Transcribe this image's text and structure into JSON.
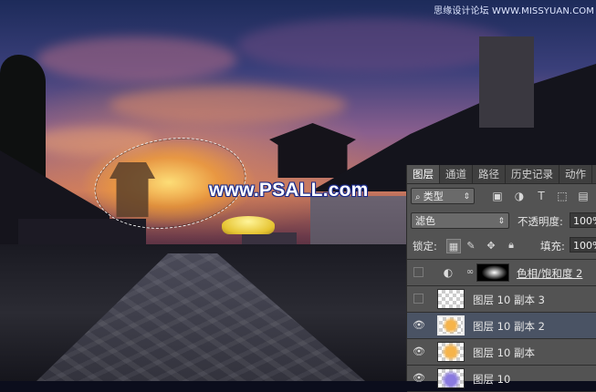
{
  "watermark": {
    "top_right": "思缘设计论坛 WWW.MISSYUAN.COM",
    "center": "www.PSALL.com"
  },
  "panel": {
    "tabs": [
      {
        "label": "图层",
        "active": true
      },
      {
        "label": "通道",
        "active": false
      },
      {
        "label": "路径",
        "active": false
      },
      {
        "label": "历史记录",
        "active": false
      },
      {
        "label": "动作",
        "active": false
      }
    ],
    "filter": {
      "kind_label": "类型"
    },
    "blend": {
      "mode": "滤色",
      "opacity_label": "不透明度:",
      "opacity_value": "100%"
    },
    "lock": {
      "label": "锁定:",
      "fill_label": "填充:",
      "fill_value": "100%"
    },
    "layers": [
      {
        "name": "色相/饱和度 2",
        "visible": false,
        "type": "adjustment"
      },
      {
        "name": "图层 10 副本 3",
        "visible": false,
        "type": "pixel"
      },
      {
        "name": "图层 10 副本 2",
        "visible": true,
        "type": "pixel",
        "selected": true
      },
      {
        "name": "图层 10 副本",
        "visible": true,
        "type": "pixel"
      },
      {
        "name": "图层 10",
        "visible": true,
        "type": "pixel"
      }
    ]
  },
  "colors": {
    "panel_bg": "#535353",
    "selected_row": "#4a5364",
    "umbrella": "#e6c432"
  }
}
